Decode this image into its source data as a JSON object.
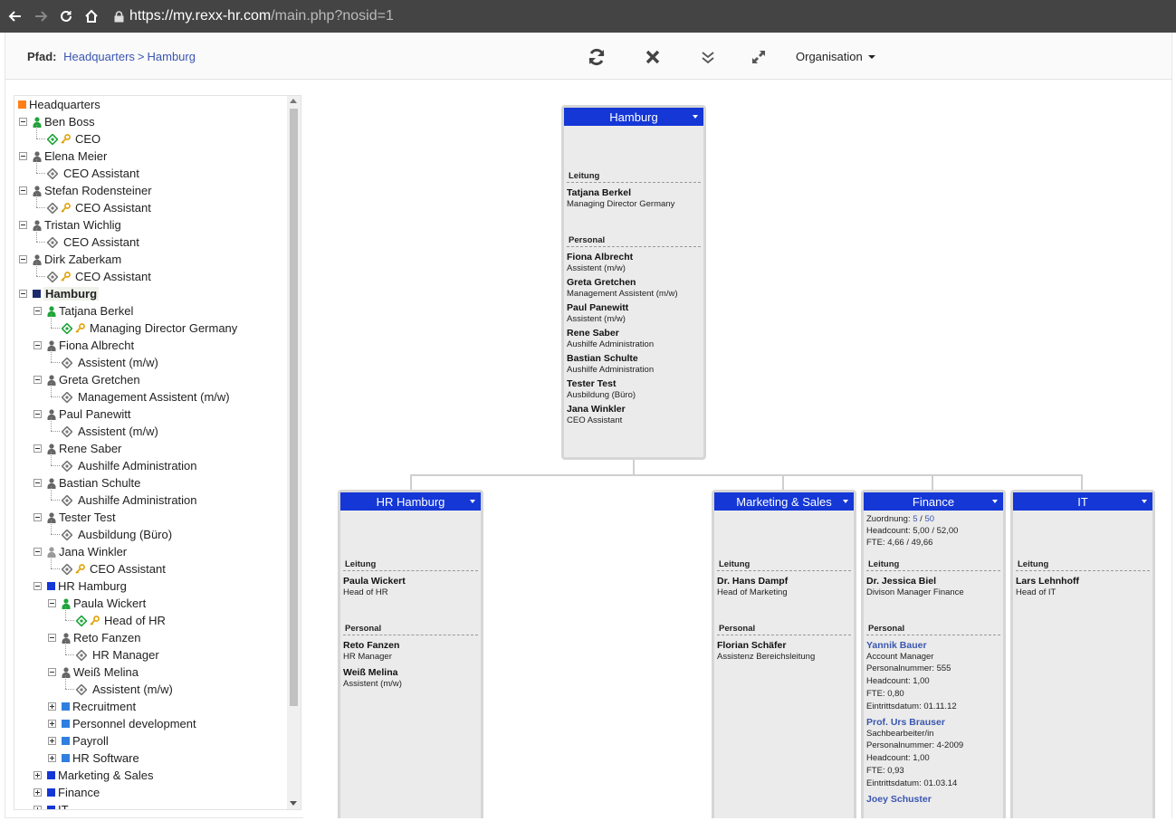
{
  "browser": {
    "url_host": "https://my.rexx-hr.com",
    "url_path": "/main.php?nosid=1"
  },
  "header": {
    "path_label": "Pfad:",
    "path_items": [
      "Headquarters",
      "Hamburg"
    ],
    "path_sep": ">",
    "tools": [
      "refresh-icon",
      "close-icon",
      "expand-all-icon",
      "fullscreen-icon"
    ],
    "org_menu_label": "Organisation"
  },
  "colors": {
    "dept_blue": "#1437d6",
    "dept_navy": "#1b2b6b",
    "dept_light": "#2f7fe0",
    "orange": "#ff7f1a",
    "person_green": "#1fa53a",
    "person_gray": "#666666",
    "link_blue": "#3a56b0"
  },
  "tree": [
    {
      "kind": "dept",
      "label": "Headquarters",
      "color": "orange",
      "level": 0
    },
    {
      "kind": "person",
      "label": "Ben Boss",
      "lead": true,
      "level": 1
    },
    {
      "kind": "position",
      "label": "CEO",
      "key": true,
      "lead": true,
      "level": 2
    },
    {
      "kind": "person",
      "label": "Elena Meier",
      "lead": false,
      "level": 1
    },
    {
      "kind": "position",
      "label": "CEO Assistant",
      "key": false,
      "lead": false,
      "level": 2
    },
    {
      "kind": "person",
      "label": "Stefan Rodensteiner",
      "lead": false,
      "level": 1
    },
    {
      "kind": "position",
      "label": "CEO Assistant",
      "key": true,
      "lead": false,
      "level": 2
    },
    {
      "kind": "person",
      "label": "Tristan Wichlig",
      "lead": false,
      "level": 1
    },
    {
      "kind": "position",
      "label": "CEO Assistant",
      "key": false,
      "lead": false,
      "level": 2
    },
    {
      "kind": "person",
      "label": "Dirk Zaberkam",
      "lead": false,
      "level": 1
    },
    {
      "kind": "position",
      "label": "CEO Assistant",
      "key": true,
      "lead": false,
      "level": 2
    },
    {
      "kind": "dept",
      "label": "Hamburg",
      "color": "navy",
      "level": 1,
      "selected": true
    },
    {
      "kind": "person",
      "label": "Tatjana Berkel",
      "lead": true,
      "level": 2
    },
    {
      "kind": "position",
      "label": "Managing Director Germany",
      "key": true,
      "lead": true,
      "level": 3
    },
    {
      "kind": "person",
      "label": "Fiona Albrecht",
      "lead": false,
      "level": 2
    },
    {
      "kind": "position",
      "label": "Assistent (m/w)",
      "key": false,
      "lead": false,
      "level": 3
    },
    {
      "kind": "person",
      "label": "Greta Gretchen",
      "lead": false,
      "level": 2
    },
    {
      "kind": "position",
      "label": "Management Assistent (m/w)",
      "key": false,
      "lead": false,
      "level": 3
    },
    {
      "kind": "person",
      "label": "Paul Panewitt",
      "lead": false,
      "level": 2
    },
    {
      "kind": "position",
      "label": "Assistent (m/w)",
      "key": false,
      "lead": false,
      "level": 3
    },
    {
      "kind": "person",
      "label": "Rene Saber",
      "lead": false,
      "level": 2
    },
    {
      "kind": "position",
      "label": "Aushilfe Administration",
      "key": false,
      "lead": false,
      "level": 3
    },
    {
      "kind": "person",
      "label": "Bastian Schulte",
      "lead": false,
      "level": 2
    },
    {
      "kind": "position",
      "label": "Aushilfe Administration",
      "key": false,
      "lead": false,
      "level": 3
    },
    {
      "kind": "person",
      "label": "Tester Test",
      "lead": false,
      "level": 2
    },
    {
      "kind": "position",
      "label": "Ausbildung (Büro)",
      "key": false,
      "lead": false,
      "level": 3
    },
    {
      "kind": "person",
      "label": "Jana Winkler",
      "lead": false,
      "level": 2,
      "pale": true
    },
    {
      "kind": "position",
      "label": "CEO Assistant",
      "key": true,
      "lead": false,
      "level": 3
    },
    {
      "kind": "dept",
      "label": "HR Hamburg",
      "color": "blue",
      "level": 2
    },
    {
      "kind": "person",
      "label": "Paula Wickert",
      "lead": true,
      "level": 3
    },
    {
      "kind": "position",
      "label": "Head of HR",
      "key": true,
      "lead": true,
      "level": 4
    },
    {
      "kind": "person",
      "label": "Reto Fanzen",
      "lead": false,
      "level": 3
    },
    {
      "kind": "position",
      "label": "HR Manager",
      "key": false,
      "lead": false,
      "level": 4
    },
    {
      "kind": "person",
      "label": "Weiß Melina",
      "lead": false,
      "level": 3
    },
    {
      "kind": "position",
      "label": "Assistent (m/w)",
      "key": false,
      "lead": false,
      "level": 4
    },
    {
      "kind": "dept",
      "label": "Recruitment",
      "color": "light",
      "level": 3,
      "collapsed": true
    },
    {
      "kind": "dept",
      "label": "Personnel development",
      "color": "light",
      "level": 3,
      "collapsed": true
    },
    {
      "kind": "dept",
      "label": "Payroll",
      "color": "light",
      "level": 3,
      "collapsed": true
    },
    {
      "kind": "dept",
      "label": "HR Software",
      "color": "light",
      "level": 3,
      "collapsed": true
    },
    {
      "kind": "dept",
      "label": "Marketing & Sales",
      "color": "blue",
      "level": 2,
      "collapsed": true
    },
    {
      "kind": "dept",
      "label": "Finance",
      "color": "blue",
      "level": 2,
      "collapsed": true
    },
    {
      "kind": "dept",
      "label": "IT",
      "color": "blue",
      "level": 2,
      "collapsed": true
    }
  ],
  "chart": {
    "root": {
      "title": "Hamburg",
      "leitung_label": "Leitung",
      "leitung": [
        {
          "name": "Tatjana Berkel",
          "role": "Managing Director Germany"
        }
      ],
      "personal_label": "Personal",
      "personal": [
        {
          "name": "Fiona Albrecht",
          "role": "Assistent (m/w)"
        },
        {
          "name": "Greta Gretchen",
          "role": "Management Assistent (m/w)"
        },
        {
          "name": "Paul Panewitt",
          "role": "Assistent (m/w)"
        },
        {
          "name": "Rene Saber",
          "role": "Aushilfe Administration"
        },
        {
          "name": "Bastian Schulte",
          "role": "Aushilfe Administration"
        },
        {
          "name": "Tester Test",
          "role": "Ausbildung (Büro)"
        },
        {
          "name": "Jana Winkler",
          "role": "CEO Assistant"
        }
      ]
    },
    "hr": {
      "title": "HR Hamburg",
      "leitung_label": "Leitung",
      "leitung": [
        {
          "name": "Paula Wickert",
          "role": "Head of HR"
        }
      ],
      "personal_label": "Personal",
      "personal": [
        {
          "name": "Reto Fanzen",
          "role": "HR Manager"
        },
        {
          "name": "Weiß Melina",
          "role": "Assistent (m/w)"
        }
      ]
    },
    "marketing": {
      "title": "Marketing & Sales",
      "leitung_label": "Leitung",
      "leitung": [
        {
          "name": "Dr. Hans Dampf",
          "role": "Head of Marketing"
        }
      ],
      "personal_label": "Personal",
      "personal": [
        {
          "name": "Florian Schäfer",
          "role": "Assistenz Bereichsleitung"
        }
      ]
    },
    "finance": {
      "title": "Finance",
      "zuordnung_label": "Zuordnung:",
      "zuordnung_a": "5",
      "zuordnung_sep": "/",
      "zuordnung_b": "50",
      "headcount": "Headcount: 5,00 / 52,00",
      "fte": "FTE: 4,66 / 49,66",
      "leitung_label": "Leitung",
      "leitung": [
        {
          "name": "Dr. Jessica Biel",
          "role": "Divison Manager Finance"
        }
      ],
      "personal_label": "Personal",
      "personal": [
        {
          "name": "Yannik Bauer",
          "role": "Account Manager",
          "details": [
            "Personalnummer: 555",
            "Headcount: 1,00",
            "FTE: 0,80",
            "Eintrittsdatum: 01.11.12"
          ]
        },
        {
          "name": "Prof. Urs Brauser",
          "role": "Sachbearbeiter/in",
          "details": [
            "Personalnummer: 4-2009",
            "Headcount: 1,00",
            "FTE: 0,93",
            "Eintrittsdatum: 01.03.14"
          ]
        },
        {
          "name": "Joey Schuster",
          "role": "",
          "details": []
        }
      ]
    },
    "it": {
      "title": "IT",
      "leitung_label": "Leitung",
      "leitung": [
        {
          "name": "Lars Lehnhoff",
          "role": "Head of IT"
        }
      ]
    }
  }
}
